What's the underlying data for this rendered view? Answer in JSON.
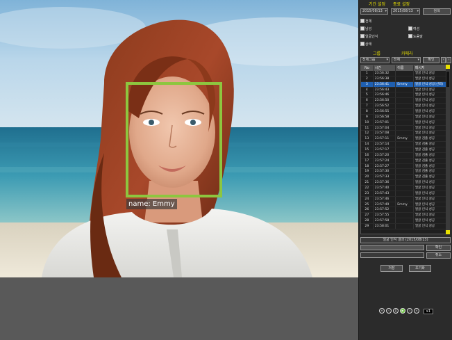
{
  "video": {
    "face_label": "name: Emmy"
  },
  "panel": {
    "filter_label_1": "기간 설정",
    "filter_label_2": "종료 설정",
    "date_from": "2015/08/13",
    "date_to": "2015/08/13",
    "search_button": "검색",
    "checks": [
      {
        "label": "전체",
        "checked": true
      },
      {
        "label": "남성",
        "checked": true
      },
      {
        "label": "여성",
        "checked": true
      },
      {
        "label": "얼굴인식",
        "checked": true
      },
      {
        "label": "도움말",
        "checked": true
      },
      {
        "label": "상태",
        "checked": true
      }
    ],
    "group_label": "그룹",
    "camera_label": "카메라",
    "group_select": "전체그룹",
    "camera_select": "전체",
    "mini_button": "확인"
  },
  "table": {
    "headers": [
      "No",
      "시간",
      "이름",
      "메시지"
    ],
    "rows": [
      [
        "1",
        "23:56:32",
        "",
        "얼굴 인식 성공"
      ],
      [
        "2",
        "23:56:38",
        "",
        "얼굴 인식 성공"
      ],
      [
        "3",
        "23:56:41",
        "Emmy",
        "얼굴 인식 성공(신뢰)"
      ],
      [
        "4",
        "23:56:43",
        "",
        "얼굴 인식 성공"
      ],
      [
        "5",
        "23:56:46",
        "",
        "얼굴 인식 성공"
      ],
      [
        "6",
        "23:56:50",
        "",
        "얼굴 인식 성공"
      ],
      [
        "7",
        "23:56:52",
        "",
        "얼굴 인식 성공"
      ],
      [
        "8",
        "23:56:55",
        "",
        "얼굴 인식 성공"
      ],
      [
        "9",
        "23:56:58",
        "",
        "얼굴 인식 성공"
      ],
      [
        "10",
        "23:57:01",
        "",
        "얼굴 인식 성공"
      ],
      [
        "11",
        "23:57:04",
        "",
        "얼굴 인식 성공"
      ],
      [
        "12",
        "23:57:08",
        "",
        "얼굴 인식 성공"
      ],
      [
        "13",
        "23:57:11",
        "Emmy",
        "얼굴 검출 성공"
      ],
      [
        "14",
        "23:57:14",
        "",
        "얼굴 검출 성공"
      ],
      [
        "15",
        "23:57:17",
        "",
        "얼굴 검출 성공"
      ],
      [
        "16",
        "23:57:20",
        "",
        "얼굴 검출 성공"
      ],
      [
        "17",
        "23:57:24",
        "",
        "얼굴 검출 성공"
      ],
      [
        "18",
        "23:57:27",
        "",
        "얼굴 검출 성공"
      ],
      [
        "19",
        "23:57:30",
        "",
        "얼굴 검출 성공"
      ],
      [
        "20",
        "23:57:33",
        "",
        "얼굴 검출 성공"
      ],
      [
        "21",
        "23:57:36",
        "",
        "얼굴 인식 성공"
      ],
      [
        "22",
        "23:57:40",
        "",
        "얼굴 인식 성공"
      ],
      [
        "23",
        "23:57:43",
        "",
        "얼굴 인식 성공"
      ],
      [
        "24",
        "23:57:46",
        "",
        "얼굴 인식 성공"
      ],
      [
        "25",
        "23:57:49",
        "Emmy",
        "얼굴 인식 성공"
      ],
      [
        "26",
        "23:57:52",
        "",
        "얼굴 인식 성공"
      ],
      [
        "27",
        "23:57:55",
        "",
        "얼굴 인식 성공"
      ],
      [
        "28",
        "23:57:58",
        "",
        "얼굴 인식 성공"
      ],
      [
        "29",
        "23:58:01",
        "",
        "얼굴 인식 성공"
      ]
    ],
    "selected_row": 2
  },
  "footer": {
    "status_text": "얼굴 인식 결과 (2015/08/13)",
    "btn_a": "저장",
    "btn_b": "초기화",
    "btn_ok": "확인",
    "btn_cancel": "취소",
    "speed_label": "x1"
  },
  "colors": {
    "face_box": "#8dc63f",
    "label_yellow": "#e8e000",
    "selected_row": "#1f5fb0",
    "play_button": "#6cc63f"
  }
}
